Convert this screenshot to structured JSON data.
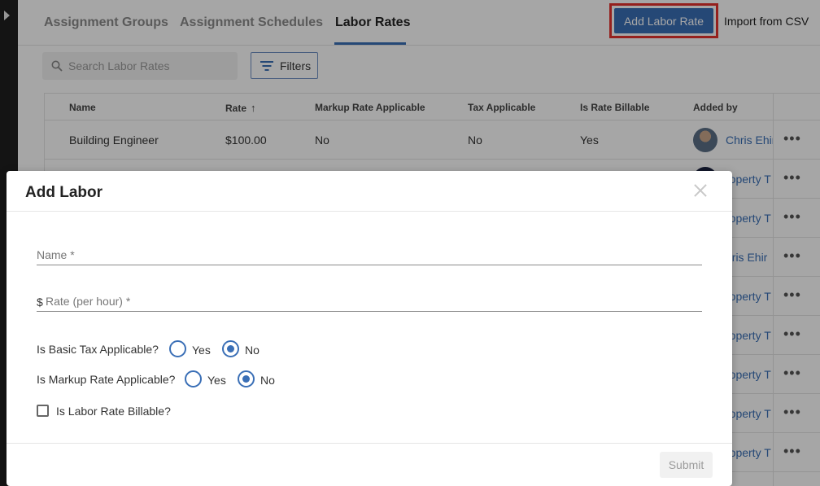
{
  "tabs": [
    {
      "label": "Assignment Groups"
    },
    {
      "label": "Assignment Schedules"
    },
    {
      "label": "Labor Rates"
    }
  ],
  "header": {
    "add_button": "Add Labor Rate",
    "import_link": "Import from CSV"
  },
  "search": {
    "placeholder": "Search Labor Rates"
  },
  "filters_label": "Filters",
  "table": {
    "columns": [
      "Name",
      "Rate",
      "Markup Rate Applicable",
      "Tax Applicable",
      "Is Rate Billable",
      "Added by"
    ],
    "rows": [
      {
        "name": "Building Engineer",
        "rate": "$100.00",
        "markup": "No",
        "tax": "No",
        "billable": "Yes",
        "added_by": "Chris Ehir"
      },
      {
        "added_by": "roperty T"
      },
      {
        "added_by": "roperty T"
      },
      {
        "added_by": "hris Ehir"
      },
      {
        "added_by": "roperty T"
      },
      {
        "added_by": "roperty T"
      },
      {
        "added_by": "roperty T"
      },
      {
        "added_by": "roperty T"
      },
      {
        "added_by": "roperty T"
      }
    ]
  },
  "modal": {
    "title": "Add Labor",
    "name_placeholder": "Name *",
    "rate_prefix": "$",
    "rate_placeholder": "Rate (per hour) *",
    "tax_question": "Is Basic Tax Applicable?",
    "markup_question": "Is Markup Rate Applicable?",
    "yes": "Yes",
    "no": "No",
    "tax_selected": "No",
    "markup_selected": "No",
    "billable_label": "Is Labor Rate Billable?",
    "billable_checked": false,
    "submit": "Submit"
  },
  "colors": {
    "accent": "#3a6fb6",
    "highlight_border": "#e5322d"
  }
}
